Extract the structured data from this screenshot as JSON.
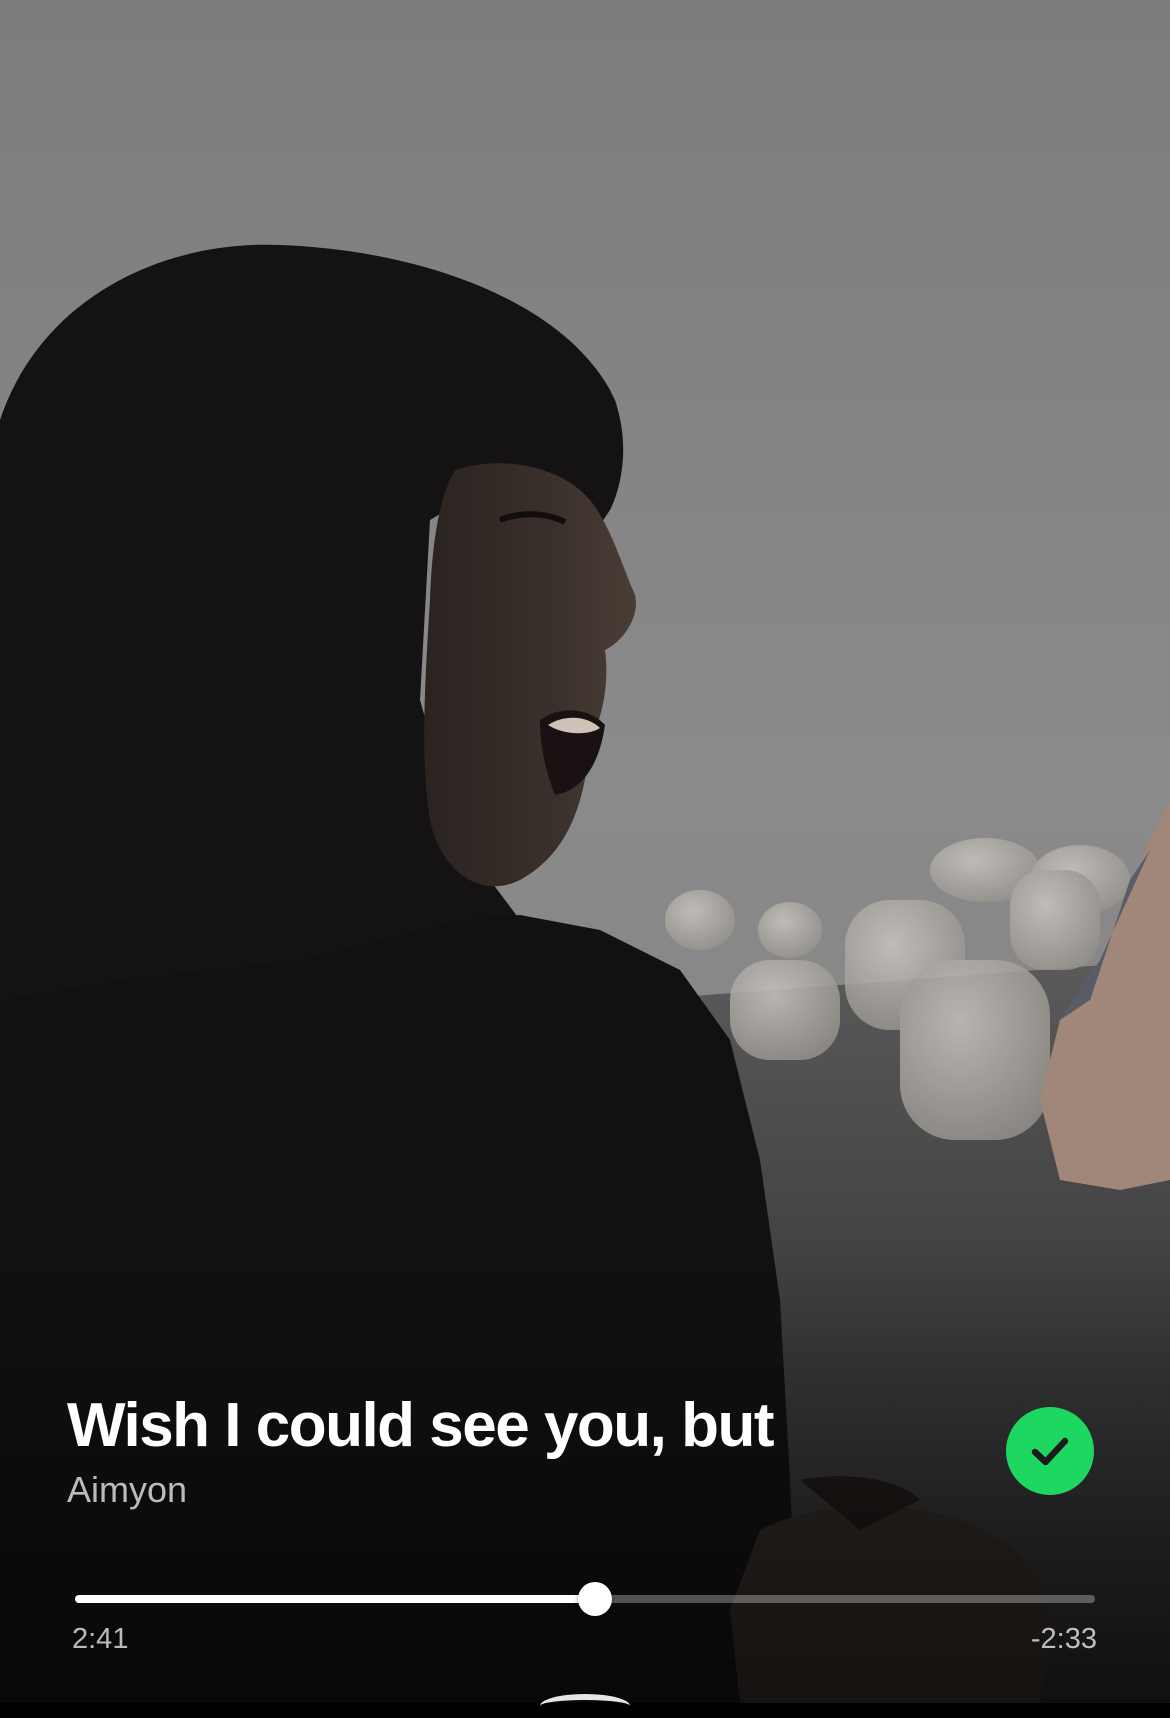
{
  "player": {
    "track_title": "Wish I could see you, but",
    "artist": "Aimyon",
    "liked": true,
    "elapsed": "2:41",
    "remaining": "-2:33",
    "progress_fraction": 0.51
  },
  "colors": {
    "accent": "#1ed760",
    "text_primary": "#ffffff",
    "text_secondary": "#b8b8b8",
    "fog": "#878787"
  },
  "icons": {
    "liked": "check-circle-icon"
  }
}
